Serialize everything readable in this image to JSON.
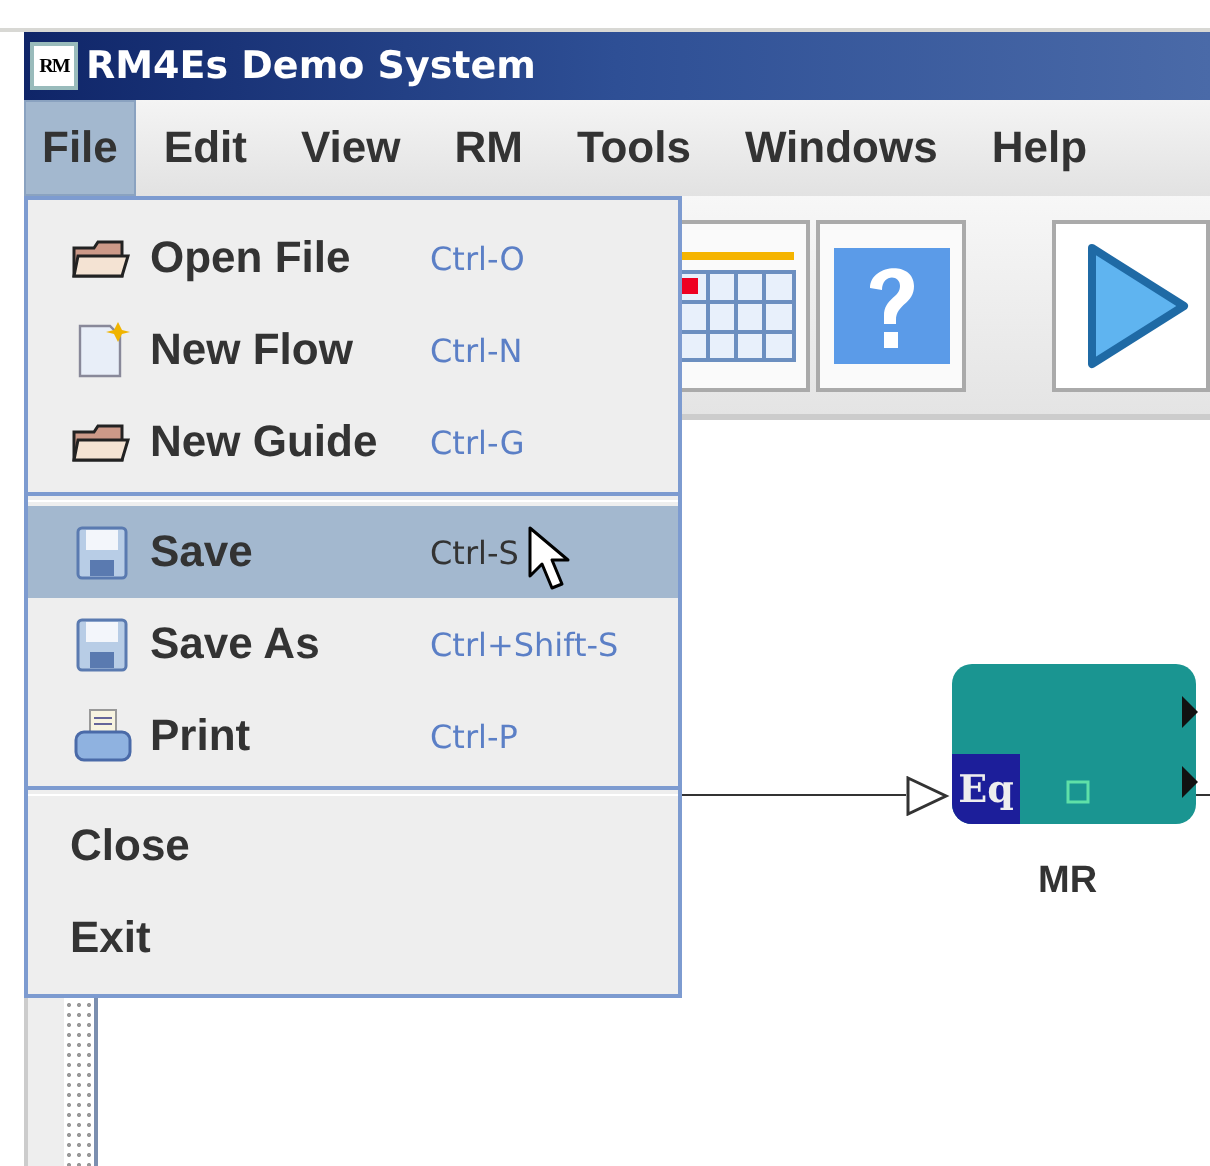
{
  "window": {
    "title": "RM4Es Demo System",
    "icon_text": "RM"
  },
  "menubar": [
    {
      "label": "File",
      "selected": true
    },
    {
      "label": "Edit",
      "selected": false
    },
    {
      "label": "View",
      "selected": false
    },
    {
      "label": "RM",
      "selected": false
    },
    {
      "label": "Tools",
      "selected": false
    },
    {
      "label": "Windows",
      "selected": false
    },
    {
      "label": "Help",
      "selected": false
    }
  ],
  "file_menu": [
    {
      "kind": "folder",
      "label": "Open File",
      "shortcut": "Ctrl-O",
      "selected": false
    },
    {
      "kind": "document",
      "label": "New Flow",
      "shortcut": "Ctrl-N",
      "selected": false
    },
    {
      "kind": "folder",
      "label": "New Guide",
      "shortcut": "Ctrl-G",
      "selected": false
    },
    {
      "kind": "separator"
    },
    {
      "kind": "disk",
      "label": "Save",
      "shortcut": "Ctrl-S",
      "selected": true
    },
    {
      "kind": "disk",
      "label": "Save As",
      "shortcut": "Ctrl+Shift-S",
      "selected": false
    },
    {
      "kind": "printer",
      "label": "Print",
      "shortcut": "Ctrl-P",
      "selected": false
    },
    {
      "kind": "separator"
    },
    {
      "kind": "plain",
      "label": "Close",
      "selected": false
    },
    {
      "kind": "plain",
      "label": "Exit",
      "selected": false
    }
  ],
  "canvas": {
    "node": {
      "label": "MR",
      "badge": "Eq"
    }
  }
}
